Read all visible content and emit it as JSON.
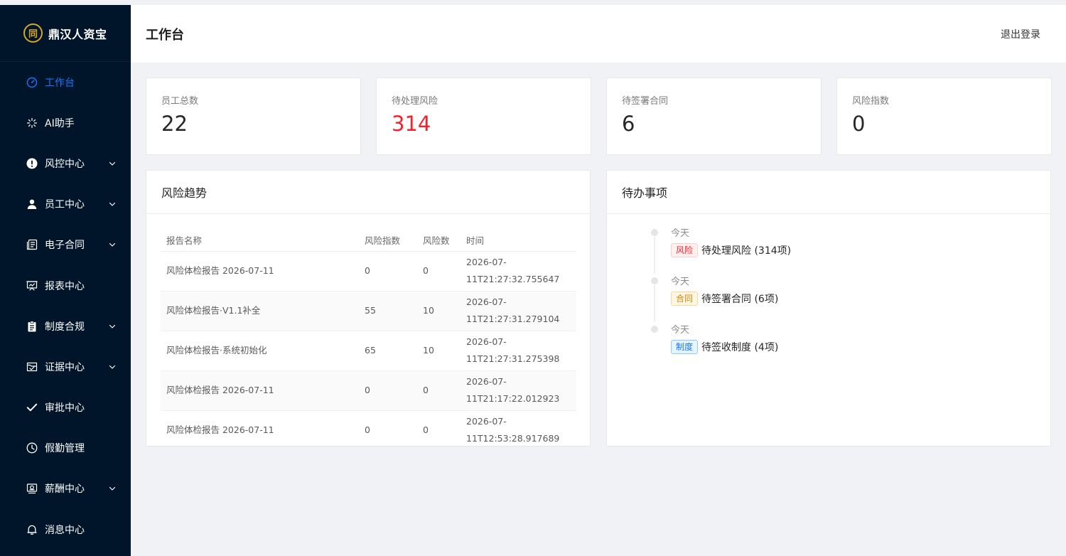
{
  "app": {
    "name": "鼎汉人资宝",
    "logo_char": "同"
  },
  "sidebar": {
    "items": [
      {
        "label": "工作台",
        "icon": "dashboard-icon",
        "active": true,
        "has_children": false
      },
      {
        "label": "AI助手",
        "icon": "sparkle-icon",
        "active": false,
        "has_children": false
      },
      {
        "label": "风控中心",
        "icon": "alert-icon",
        "active": false,
        "has_children": true
      },
      {
        "label": "员工中心",
        "icon": "user-icon",
        "active": false,
        "has_children": true
      },
      {
        "label": "电子合同",
        "icon": "contract-icon",
        "active": false,
        "has_children": true
      },
      {
        "label": "报表中心",
        "icon": "presentation-icon",
        "active": false,
        "has_children": false
      },
      {
        "label": "制度合规",
        "icon": "clipboard-icon",
        "active": false,
        "has_children": true
      },
      {
        "label": "证据中心",
        "icon": "evidence-icon",
        "active": false,
        "has_children": true
      },
      {
        "label": "审批中心",
        "icon": "check-icon",
        "active": false,
        "has_children": false
      },
      {
        "label": "假勤管理",
        "icon": "clock-icon",
        "active": false,
        "has_children": false
      },
      {
        "label": "薪酬中心",
        "icon": "salary-icon",
        "active": false,
        "has_children": true
      },
      {
        "label": "消息中心",
        "icon": "bell-icon",
        "active": false,
        "has_children": false
      }
    ]
  },
  "header": {
    "title": "工作台",
    "logout_label": "退出登录"
  },
  "stats": [
    {
      "label": "员工总数",
      "value": "22",
      "highlight": false
    },
    {
      "label": "待处理风险",
      "value": "314",
      "highlight": true
    },
    {
      "label": "待签署合同",
      "value": "6",
      "highlight": false
    },
    {
      "label": "风险指数",
      "value": "0",
      "highlight": false
    }
  ],
  "risk_trend": {
    "title": "风险趋势",
    "columns": [
      "报告名称",
      "风险指数",
      "风险数",
      "时间"
    ],
    "rows": [
      {
        "name": "风险体检报告 2026-07-11",
        "index": "0",
        "count": "0",
        "time_a": "2026-07-",
        "time_b": "11T21:27:32.755647"
      },
      {
        "name": "风险体检报告·V1.1补全",
        "index": "55",
        "count": "10",
        "time_a": "2026-07-",
        "time_b": "11T21:27:31.279104"
      },
      {
        "name": "风险体检报告·系统初始化",
        "index": "65",
        "count": "10",
        "time_a": "2026-07-",
        "time_b": "11T21:27:31.275398"
      },
      {
        "name": "风险体检报告 2026-07-11",
        "index": "0",
        "count": "0",
        "time_a": "2026-07-",
        "time_b": "11T21:17:22.012923"
      },
      {
        "name": "风险体检报告 2026-07-11",
        "index": "0",
        "count": "0",
        "time_a": "2026-07-",
        "time_b": "11T12:53:28.917689"
      }
    ]
  },
  "todo": {
    "title": "待办事项",
    "items": [
      {
        "date": "今天",
        "tag": "风险",
        "tag_type": "risk",
        "text": "待处理风险 (314项)"
      },
      {
        "date": "今天",
        "tag": "合同",
        "tag_type": "contract",
        "text": "待签署合同 (6项)"
      },
      {
        "date": "今天",
        "tag": "制度",
        "tag_type": "policy",
        "text": "待签收制度 (4项)"
      }
    ]
  },
  "colors": {
    "sidebar_bg": "#001529",
    "accent": "#1677ff",
    "danger": "#f5222d",
    "warning": "#d48806"
  }
}
